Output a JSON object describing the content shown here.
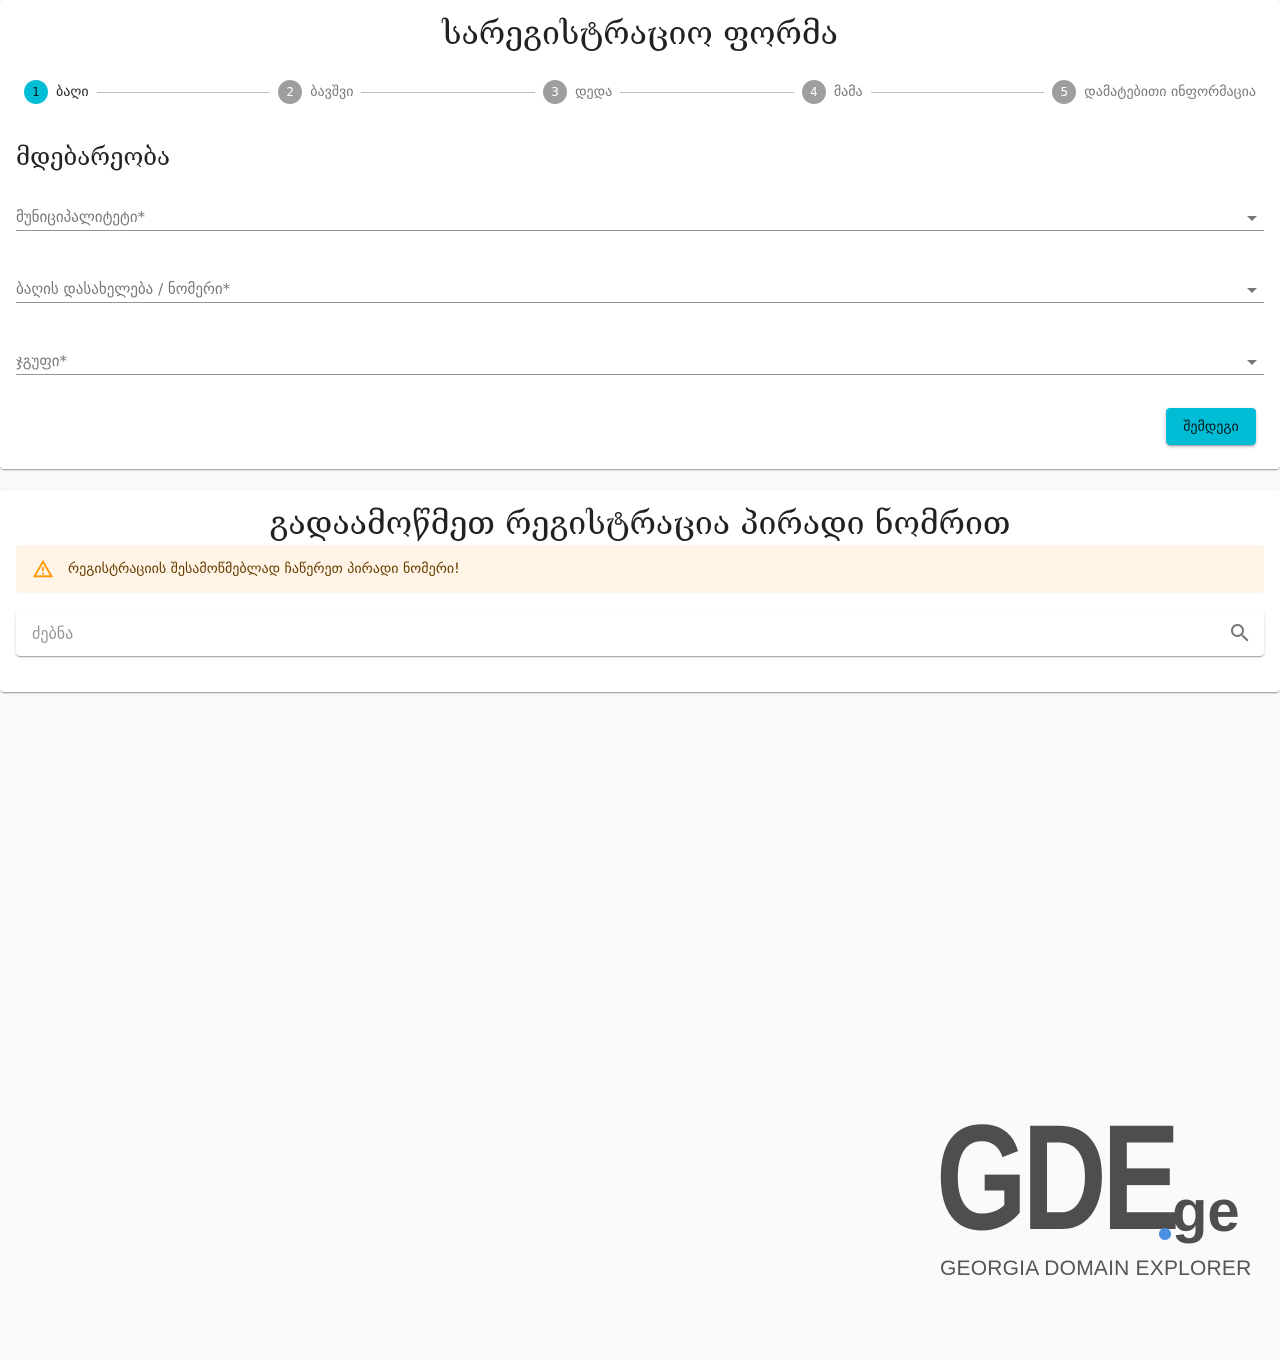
{
  "registration": {
    "title": "სარეგისტრაციო ფორმა",
    "steps": [
      {
        "number": "1",
        "label": "ბაღი",
        "active": true
      },
      {
        "number": "2",
        "label": "ბავშვი",
        "active": false
      },
      {
        "number": "3",
        "label": "დედა",
        "active": false
      },
      {
        "number": "4",
        "label": "მამა",
        "active": false
      },
      {
        "number": "5",
        "label": "დამატებითი ინფორმაცია",
        "active": false
      }
    ],
    "section_title": "მდებარეობა",
    "fields": {
      "municipality": "მუნიციპალიტეტი*",
      "kindergarten": "ბაღის დასახელება / ნომერი*",
      "group": "ჯგუფი*"
    },
    "next_button": "შემდეგი"
  },
  "check": {
    "title": "გადაამოწმეთ რეგისტრაცია პირადი ნომრით",
    "alert_text": "რეგისტრაციის შესამოწმებლად ჩაწერეთ პირადი ნომერი!",
    "search_placeholder": "ძებნა"
  },
  "logo": {
    "letters": "GDE",
    "suffix": "ge",
    "subtitle": "GEORGIA DOMAIN EXPLORER"
  },
  "colors": {
    "accent": "#00bcd4",
    "inactive_step": "#9e9e9e",
    "alert_bg": "#fff4e5",
    "alert_icon": "#ff9800",
    "logo_dot": "#4a90e2"
  },
  "icons": {
    "alert": "warning-icon",
    "search": "search-icon",
    "select": "dropdown-arrow-icon"
  }
}
